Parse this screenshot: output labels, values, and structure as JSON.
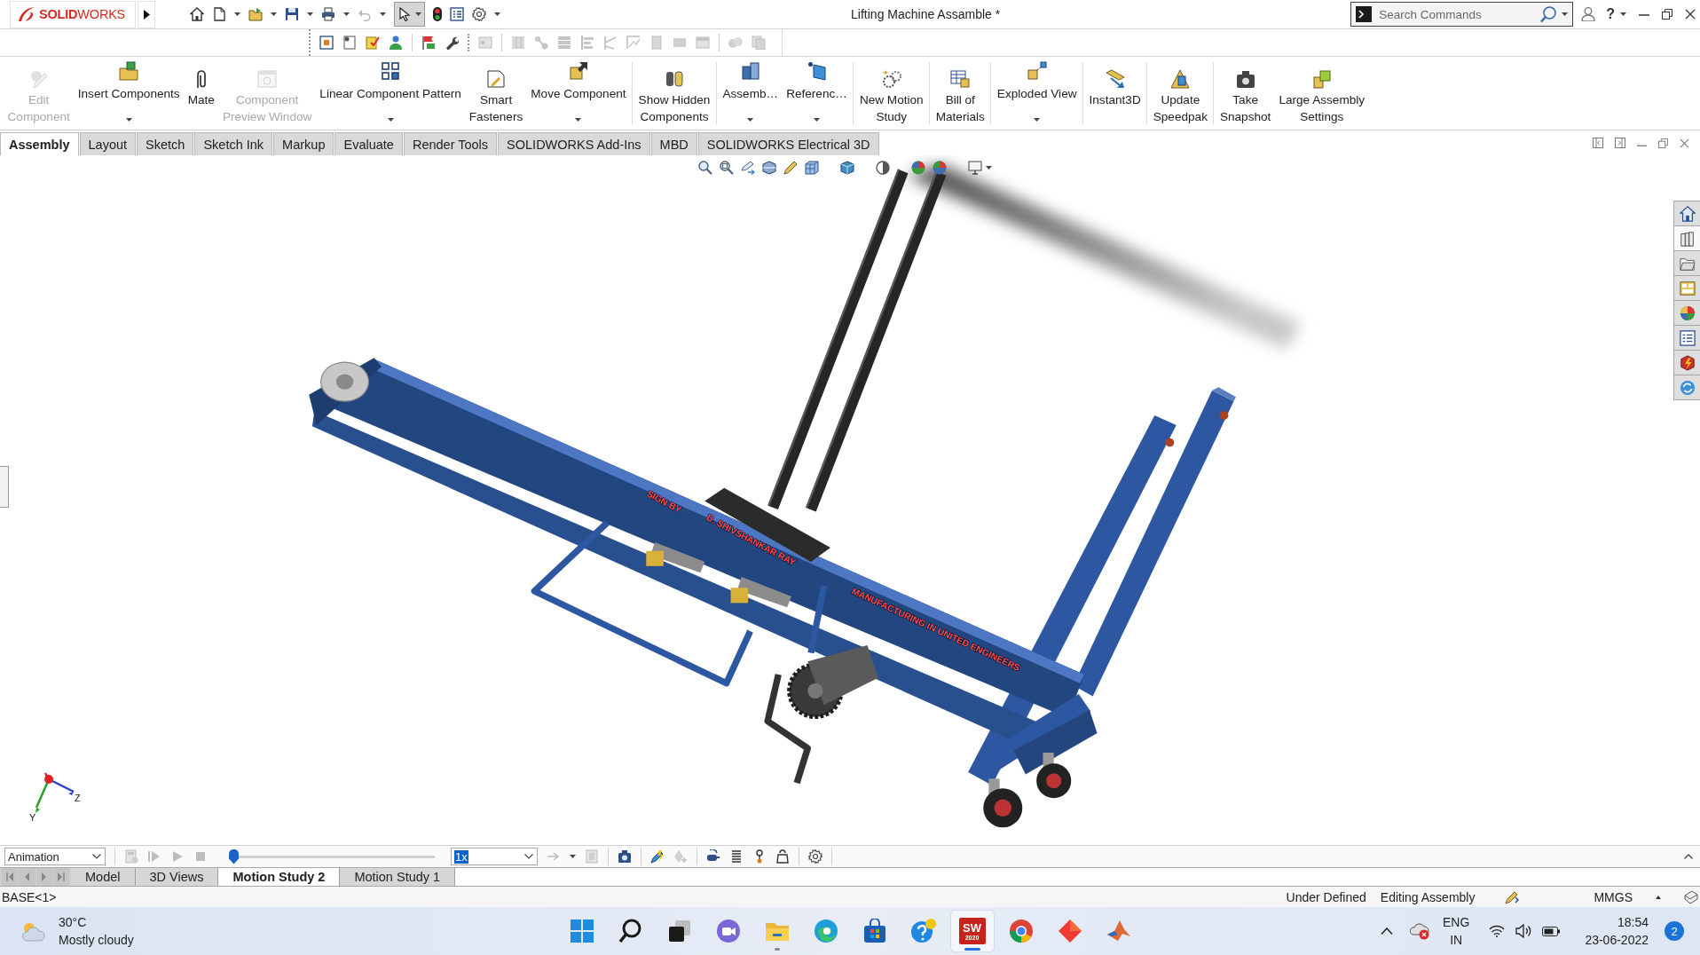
{
  "app_bar": {
    "logo": "**SOLID**WORKS",
    "undo": {
      "disabled": true
    },
    "select_tool": {
      "pressed": true
    },
    "title": "Lifting Machine Assamble *",
    "search": {
      "placeholder": "Search Commands"
    },
    "help": "?"
  },
  "ribbon": {
    "groups": [
      {
        "commands": [
          {
            "label": "Edit\nComponent",
            "disabled": true,
            "dropdown": false
          },
          {
            "label": "Insert Components",
            "disabled": false,
            "dropdown": true
          },
          {
            "label": "Mate",
            "disabled": false,
            "dropdown": false
          },
          {
            "label": "Component\nPreview Window",
            "disabled": true,
            "dropdown": false
          },
          {
            "label": "Linear Component Pattern",
            "disabled": false,
            "dropdown": true
          },
          {
            "label": "Smart\nFasteners",
            "disabled": false,
            "dropdown": false
          },
          {
            "label": "Move Component",
            "disabled": false,
            "dropdown": true
          }
        ]
      },
      {
        "commands": [
          {
            "label": "Show Hidden\nComponents",
            "disabled": false,
            "dropdown": false
          }
        ]
      },
      {
        "commands": [
          {
            "label": "Assemb…",
            "disabled": false,
            "dropdown": true
          },
          {
            "label": "Referenc…",
            "disabled": false,
            "dropdown": true
          }
        ]
      },
      {
        "commands": [
          {
            "label": "New Motion\nStudy",
            "disabled": false,
            "dropdown": false
          }
        ]
      },
      {
        "commands": [
          {
            "label": "Bill of\nMaterials",
            "disabled": false,
            "dropdown": false
          }
        ]
      },
      {
        "commands": [
          {
            "label": "Exploded View",
            "disabled": false,
            "dropdown": true
          }
        ]
      },
      {
        "commands": [
          {
            "label": "Instant3D",
            "disabled": false,
            "dropdown": false
          }
        ]
      },
      {
        "commands": [
          {
            "label": "Update\nSpeedpak",
            "disabled": false,
            "dropdown": false
          }
        ]
      },
      {
        "commands": [
          {
            "label": "Take\nSnapshot",
            "disabled": false,
            "dropdown": false
          },
          {
            "label": "Large Assembly\nSettings",
            "disabled": false,
            "dropdown": false
          }
        ]
      }
    ]
  },
  "tabs": [
    {
      "label": "Assembly",
      "selected": true
    },
    {
      "label": "Layout",
      "selected": false
    },
    {
      "label": "Sketch",
      "selected": false
    },
    {
      "label": "Sketch Ink",
      "selected": false
    },
    {
      "label": "Markup",
      "selected": false
    },
    {
      "label": "Evaluate",
      "selected": false
    },
    {
      "label": "Render Tools",
      "selected": false
    },
    {
      "label": "SOLIDWORKS Add-Ins",
      "selected": false
    },
    {
      "label": "MBD",
      "selected": false
    },
    {
      "label": "SOLIDWORKS Electrical 3D",
      "selected": false
    }
  ],
  "viewport": {
    "task_pane_tabs": [
      {
        "selected": false
      },
      {
        "selected": true
      },
      {
        "selected": false
      },
      {
        "selected": false
      },
      {
        "selected": false
      },
      {
        "selected": false
      },
      {
        "selected": false
      },
      {
        "selected": false
      }
    ],
    "model_labels": [
      "SIGN BY",
      "D. SHIVSHANKAR RAY",
      "MANUFACTURING IN UNITED ENGINEERS"
    ],
    "triad_axes": [
      "Y",
      "Z"
    ]
  },
  "motion_study": {
    "study_type": "Animation",
    "timeline": {
      "level": 0
    },
    "playback_speed": {
      "value": "1x",
      "highlighted": true
    }
  },
  "study_tabs": [
    {
      "label": "Model",
      "selected": false
    },
    {
      "label": "3D Views",
      "selected": false
    },
    {
      "label": "Motion Study 2",
      "selected": true
    },
    {
      "label": "Motion Study 1",
      "selected": false
    }
  ],
  "status_bar": {
    "selection": "BASE<1>",
    "state": "Under Defined",
    "mode": "Editing Assembly",
    "units": "MMGS"
  },
  "taskbar": {
    "weather": {
      "temperature": "30°C",
      "condition": "Mostly cloudy"
    },
    "apps": [
      {
        "kind": "start",
        "running": false,
        "active": false
      },
      {
        "kind": "search",
        "running": false,
        "active": false
      },
      {
        "kind": "task-view",
        "running": false,
        "active": false
      },
      {
        "kind": "chat",
        "running": false,
        "active": false
      },
      {
        "kind": "folder",
        "running": true,
        "active": false
      },
      {
        "kind": "edge",
        "running": false,
        "active": false
      },
      {
        "kind": "store",
        "running": false,
        "active": false
      },
      {
        "kind": "tips",
        "running": false,
        "active": false
      },
      {
        "kind": "solidworks",
        "label": "SW",
        "version": "2020",
        "running": true,
        "active": true
      },
      {
        "kind": "chrome",
        "running": false,
        "active": false
      },
      {
        "kind": "diamond",
        "running": false,
        "active": false
      },
      {
        "kind": "matlab",
        "running": false,
        "active": false
      }
    ],
    "tray": {
      "language": "ENG",
      "region": "IN",
      "time": "18:54",
      "date": "23-06-2022",
      "notifications": "2"
    }
  }
}
